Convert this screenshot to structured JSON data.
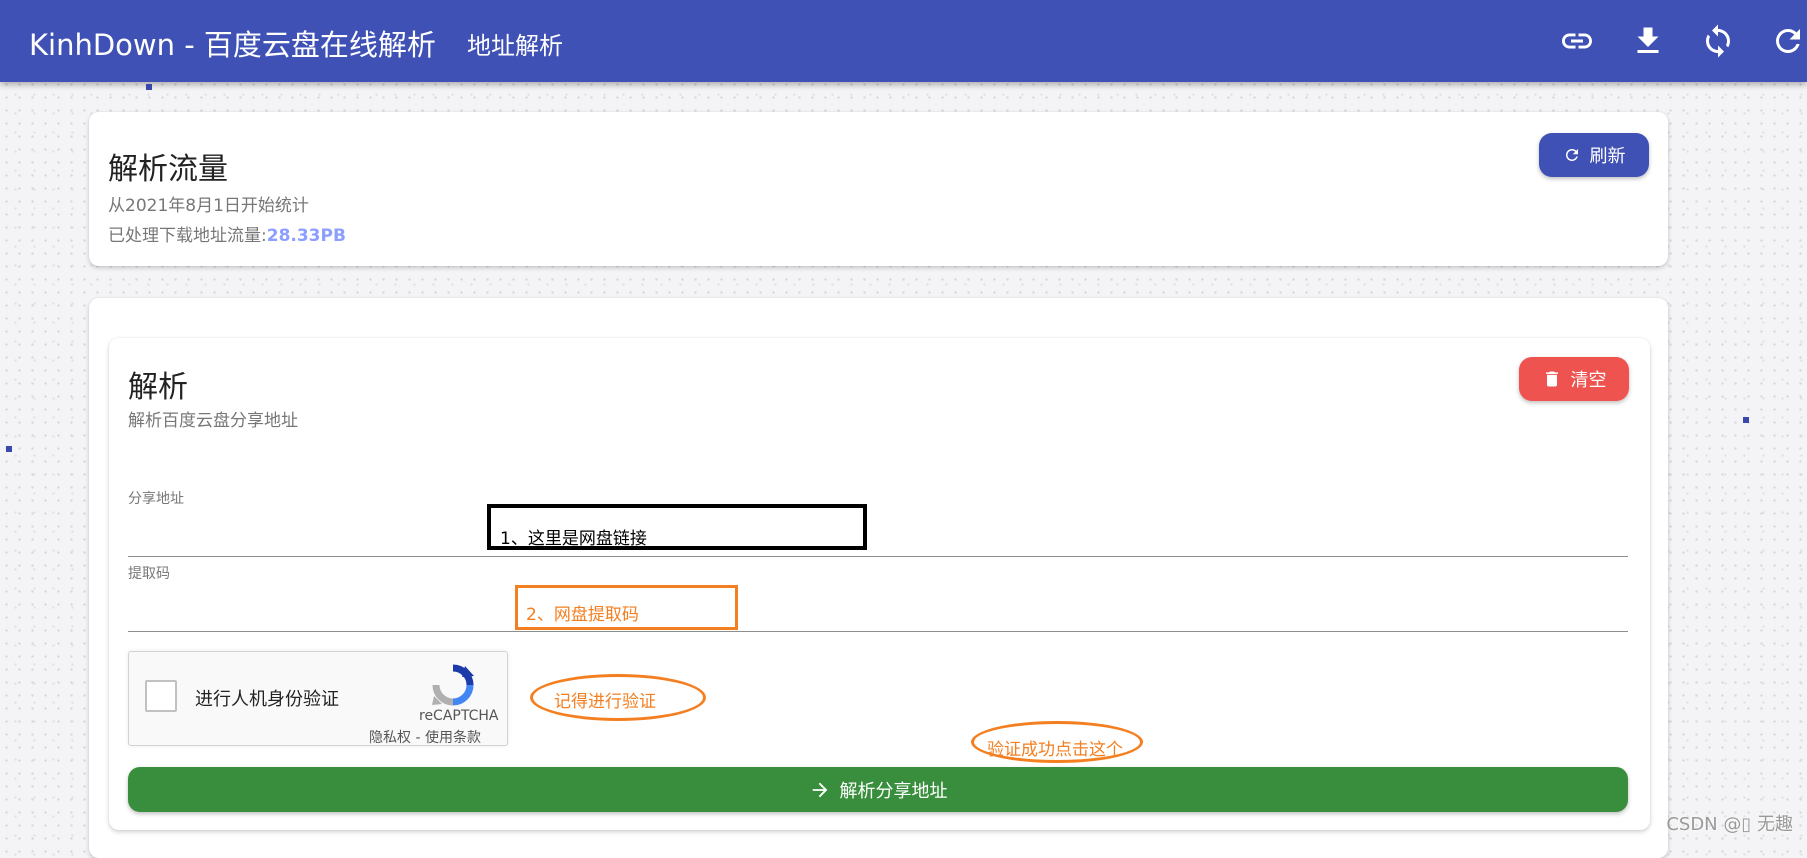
{
  "appbar": {
    "title": "KinhDown - 百度云盘在线解析",
    "subtitle": "地址解析",
    "icons": [
      "link-icon",
      "download-icon",
      "sync-icon",
      "reload-icon"
    ]
  },
  "traffic": {
    "title": "解析流量",
    "since": "从2021年8月1日开始统计",
    "amount_label": "已处理下载地址流量:",
    "amount_value": "28.33PB",
    "refresh_label": "刷新"
  },
  "parse": {
    "title": "解析",
    "description": "解析百度云盘分享地址",
    "clear_label": "清空",
    "share_url_label": "分享地址",
    "share_url_value": "",
    "code_label": "提取码",
    "code_value": "",
    "submit_label": "解析分享地址"
  },
  "recaptcha": {
    "label": "进行人机身份验证",
    "brand": "reCAPTCHA",
    "terms": "隐私权 - 使用条款"
  },
  "annotations": {
    "link_hint": "1、这里是网盘链接",
    "code_hint": "2、网盘提取码",
    "verify_hint": "记得进行验证",
    "click_hint": "验证成功点击这个"
  },
  "watermark": "CSDN @▯ 无趣",
  "colors": {
    "primary": "#3f51b5",
    "danger": "#ef5350",
    "success": "#388e3c",
    "accent_value": "#8c9eff",
    "annotation": "#f47f20"
  }
}
